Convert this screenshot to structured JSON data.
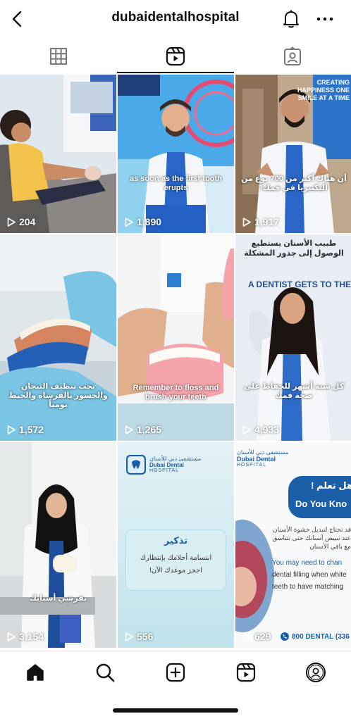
{
  "header": {
    "username": "dubaidentalhospital"
  },
  "tabs": [
    {
      "name": "posts-grid",
      "icon": "grid-icon"
    },
    {
      "name": "reels",
      "icon": "reels-icon",
      "active": true
    },
    {
      "name": "tagged",
      "icon": "tagged-icon"
    }
  ],
  "reels": [
    {
      "views": "204",
      "caption": ""
    },
    {
      "views": "1,890",
      "caption": "as soon as the first tooth erupts"
    },
    {
      "views": "1,917",
      "caption": "أن هناك أكثر من 700 نوع من البكتيريا في فمك!"
    },
    {
      "views": "1,572",
      "caption": "يجب تنظيف التيجان والجسور بالفرشاة والخيط يومياً"
    },
    {
      "views": "1,265",
      "caption": "Remember to floss and brush your teeth"
    },
    {
      "views": "4,933",
      "caption": "كل ستة أشهر للحفاظ على صحة فمك",
      "overlay_ar": "طبيب الأسنان يستطيع الوصول إلى جذور المشكلة",
      "overlay_en": "A DENTIST GETS TO THE"
    },
    {
      "views": "3,154",
      "caption": "بفرشي أسنانك"
    },
    {
      "views": "556",
      "logo_ar": "مستشفى دبي للأسنان",
      "logo_en_1": "Dubai Dental",
      "logo_en_2": "HOSPITAL",
      "card_title": "تذكير",
      "card_line1": "ابتسامة أحلامك بإنتظارك",
      "card_line2": "احجز موعدك الآن!"
    },
    {
      "views": "629",
      "logo_ar": "مستشفى دبي للأسنان",
      "logo_en_1": "Dubai Dental",
      "logo_en_2": "HOSPITAL",
      "bubble_ar": "هل تعلم !",
      "bubble_en": "Do You Kno",
      "text_ar": "قد تحتاج لتبديل حشوة الأسنان عند تبييض أسنانك حتى تتناسق مع باقي الأسنان",
      "text_en_1": "You may need to chan",
      "text_en_2": "dental filling when white",
      "text_en_3": "teeth to have matching",
      "phone": "800 DENTAL (336"
    }
  ],
  "banner_text": {
    "tile3": "CREATING HAPPINESS ONE SMILE AT A TIME"
  },
  "colors": {
    "accent_blue": "#1a64a8",
    "tile_bg_light": "#e8eef2"
  }
}
